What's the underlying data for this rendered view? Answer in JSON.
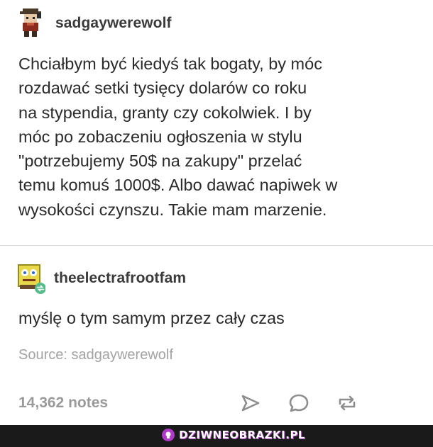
{
  "post": {
    "author": "sadgaywerewolf",
    "text": "Chciałbym być kiedyś tak bogaty, by móc\nrozdawać setki tysięcy dolarów co roku\nna stypendia, granty czy cokolwiek. I by\nmóc po zobaczeniu ogłoszenia w stylu\n\"potrzebujemy 50$ na zakupy\" przelać\ntemu komuś 1000$. Albo dawać napiwek w\nwysokości czynszu. Takie mam marzenie."
  },
  "reply": {
    "author": "theelectrafrootfam",
    "text": "myślę o tym samym przez cały czas"
  },
  "source": {
    "label": "Source: ",
    "value": "sadgaywerewolf"
  },
  "notes": "14,362 notes",
  "icons": {
    "share": "paper-plane-icon",
    "reply": "speech-bubble-icon",
    "reblog": "reblog-icon"
  },
  "colors": {
    "icon": "#8e8e8e",
    "reblog_badge": "#56bc8a",
    "footer_bg": "#1a1a1a",
    "brand_accent": "#b03ac8"
  },
  "footer": {
    "brand": "DZIWNEOBRAZKI.PL"
  }
}
